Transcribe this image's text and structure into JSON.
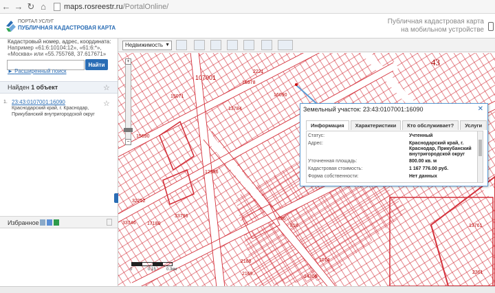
{
  "browser": {
    "url_domain": "maps.rosreestr.ru",
    "url_path": "/PortalOnline/"
  },
  "header": {
    "logo_line1": "ПОРТАЛ УСЛУГ",
    "logo_line2": "ПУБЛИЧНАЯ КАДАСТРОВАЯ КАРТА",
    "mobile_line1": "Публичная кадастровая карта",
    "mobile_line2": "на мобильном устройстве"
  },
  "search": {
    "label_line1": "Кадастровый номер, адрес, координата:",
    "label_line2": "Например «61:6:10104:12», «61:6:*»,",
    "label_line3": "«Москва» или «55.755768, 37.617671»",
    "placeholder": "",
    "find_button": "Найти",
    "advanced_link": "Расширенный поиск"
  },
  "results": {
    "found_prefix": "Найден",
    "found_count": "1 объект",
    "items": [
      {
        "number": "1.",
        "cadastral": "23:43:0107001:16090",
        "address_line1": "Краснодарский край, г. Краснодар,",
        "address_line2": "Прикубанский внутригородской округ"
      }
    ]
  },
  "favorites": {
    "label": "Избранное"
  },
  "toolbar": {
    "layer_select": "Недвижимость"
  },
  "map": {
    "zoom_in": "+",
    "zoom_out": "−",
    "scale_labels": [
      "0",
      "0.15",
      "0.3км"
    ],
    "quarter_number": "43",
    "labels": [
      "107001",
      "2221",
      "16978",
      "15071",
      "15690",
      "13784",
      "17180",
      "12986",
      "33796",
      "32252",
      "1014",
      "14306",
      "2188",
      "2169",
      "2361",
      "16090",
      "33746",
      "896",
      "818",
      "13761"
    ]
  },
  "popup": {
    "title": "Земельный участок: 23:43:0107001:16090",
    "tabs": [
      "Информация",
      "Характеристики",
      "Кто обслуживает?",
      "Услуги"
    ],
    "rows": [
      {
        "label": "Статус:",
        "value": "Учтенный"
      },
      {
        "label": "Адрес:",
        "value": "Краснодарский край, г. Краснодар, Прикубанский внутригородской округ"
      },
      {
        "label": "Уточненная площадь:",
        "value": "800.00 кв. м"
      },
      {
        "label": "Кадастровая стоимость:",
        "value": "1 167 776.00 руб."
      },
      {
        "label": "Форма собственности:",
        "value": "Нет данных"
      }
    ]
  },
  "colors": {
    "accent": "#2a6db5",
    "parcel_line": "#d4313b",
    "popup_border": "#5b9bd5"
  }
}
